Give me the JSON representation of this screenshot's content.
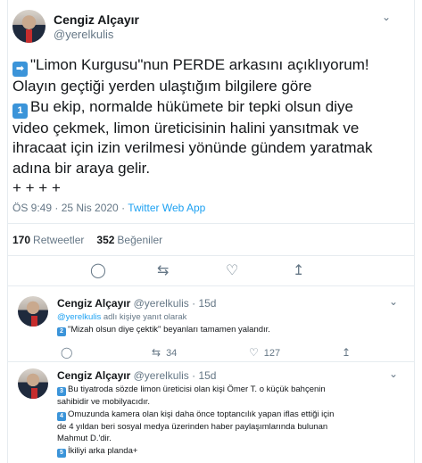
{
  "main": {
    "author_name": "Cengiz Alçayır",
    "handle": "@yerelkulis",
    "lines": [
      {
        "prefix": "➡",
        "text": "\"Limon Kurgusu\"nun PERDE arkasını açıklıyorum!"
      },
      {
        "prefix": "",
        "text": "Olayın geçtiği yerden ulaştığım bilgilere göre"
      },
      {
        "prefix": "1",
        "text": "Bu ekip, normalde hükümete bir tepki olsun diye"
      },
      {
        "prefix": "",
        "text": "video çekmek, limon üreticisinin halini yansıtmak ve"
      },
      {
        "prefix": "",
        "text": "ihracaat için izin verilmesi yönünde gündem yaratmak"
      },
      {
        "prefix": "",
        "text": "adına bir araya gelir."
      },
      {
        "prefix": "",
        "text": "+ + + +"
      }
    ],
    "time": "ÖS 9:49 · 25 Nis 2020",
    "separator": " · ",
    "source": "Twitter Web App",
    "retweets_count": "170",
    "retweets_label": "Retweetler",
    "likes_count": "352",
    "likes_label": "Beğeniler"
  },
  "replies": [
    {
      "author_name": "Cengiz Alçayır",
      "meta": "@yerelkulis · 15d",
      "reply_to_handle": "@yerelkulis",
      "reply_to_suffix": " adlı kişiye yanıt olarak",
      "lines": [
        {
          "num": "2",
          "text": "\"Mizah olsun diye çektik\" beyanları tamamen yalandır."
        }
      ],
      "retweets": "34",
      "likes": "127"
    },
    {
      "author_name": "Cengiz Alçayır",
      "meta": "@yerelkulis · 15d",
      "lines": [
        {
          "num": "3",
          "text": "Bu tiyatroda sözde limon üreticisi olan kişi Ömer T. o küçük bahçenin"
        },
        {
          "num": "",
          "text": "sahibidir ve mobilyacıdır."
        },
        {
          "num": "4",
          "text": "Omuzunda kamera olan kişi daha önce toptancılık yapan iflas ettiği için"
        },
        {
          "num": "",
          "text": "de 4 yıldan beri sosyal medya üzerinden haber paylaşımlarında bulunan"
        },
        {
          "num": "",
          "text": "Mahmut D.'dir."
        },
        {
          "num": "5",
          "text": "İkiliyi arka planda+"
        }
      ]
    }
  ]
}
